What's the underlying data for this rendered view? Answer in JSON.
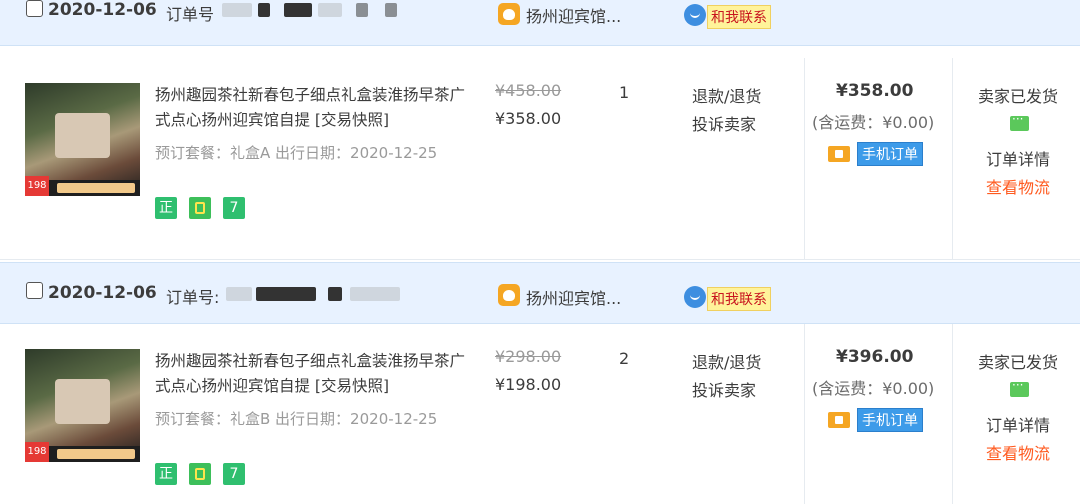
{
  "orders": [
    {
      "date": "2020-12-06",
      "order_no_label": "订单号",
      "shop_name": "扬州迎宾馆...",
      "contact_label": "和我联系",
      "item_title": "扬州趣园茶社新春包子细点礼盒装淮扬早茶广式点心扬州迎宾馆自提 [交易快照]",
      "item_meta": "预订套餐：礼盒A  出行日期：2020-12-25",
      "thumb_price": "198",
      "original_price": "¥458.00",
      "price": "¥358.00",
      "quantity": "1",
      "refund_label": "退款/退货",
      "complain_label": "投诉卖家",
      "total": "¥358.00",
      "shipping": "(含运费：¥0.00)",
      "mobile_order_label": "手机订单",
      "status": "卖家已发货",
      "detail_label": "订单详情",
      "logistics_label": "查看物流",
      "badges": [
        "正",
        "",
        "7"
      ]
    },
    {
      "date": "2020-12-06",
      "order_no_label": "订单号:",
      "shop_name": "扬州迎宾馆...",
      "contact_label": "和我联系",
      "item_title": "扬州趣园茶社新春包子细点礼盒装淮扬早茶广式点心扬州迎宾馆自提 [交易快照]",
      "item_meta": "预订套餐：礼盒B  出行日期：2020-12-25",
      "thumb_price": "198",
      "original_price": "¥298.00",
      "price": "¥198.00",
      "quantity": "2",
      "refund_label": "退款/退货",
      "complain_label": "投诉卖家",
      "total": "¥396.00",
      "shipping": "(含运费：¥0.00)",
      "mobile_order_label": "手机订单",
      "status": "卖家已发货",
      "detail_label": "订单详情",
      "logistics_label": "查看物流",
      "badges": [
        "正",
        "",
        "7"
      ]
    }
  ],
  "colors": {
    "header_bg": "#e8f2ff",
    "logistics_link": "#ff5a1f",
    "contact_text": "#c8141e",
    "badge_green": "#2fbf6f",
    "mobile_badge": "#3d9be9"
  }
}
